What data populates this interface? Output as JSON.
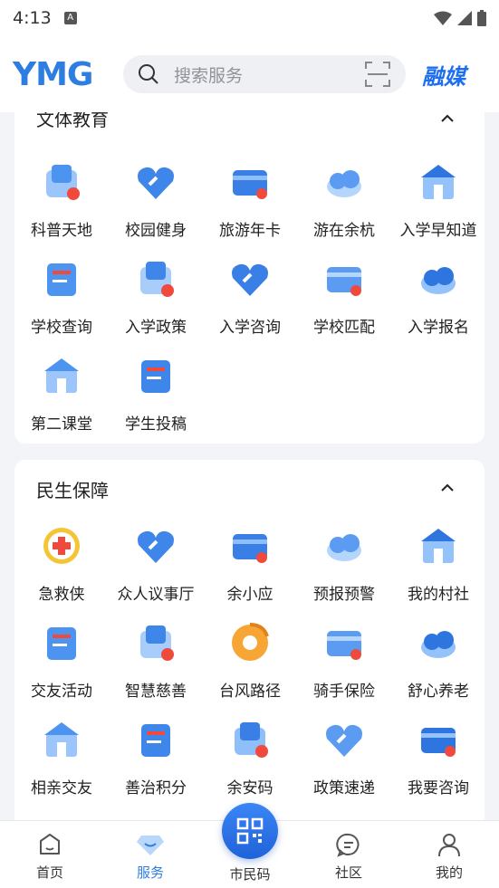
{
  "status": {
    "time": "4:13"
  },
  "header": {
    "logo": "YMG",
    "search_placeholder": "搜索服务",
    "brand": "融媒"
  },
  "culture": {
    "title": "文体教育",
    "items": [
      {
        "label": "科普天地",
        "icon": "orbit-icon"
      },
      {
        "label": "校园健身",
        "icon": "fitness-icon"
      },
      {
        "label": "旅游年卡",
        "icon": "travel-card-icon"
      },
      {
        "label": "游在余杭",
        "icon": "tourism-icon"
      },
      {
        "label": "入学早知道",
        "icon": "school-building-icon"
      },
      {
        "label": "学校查询",
        "icon": "school-query-icon"
      },
      {
        "label": "入学政策",
        "icon": "books-icon"
      },
      {
        "label": "入学咨询",
        "icon": "consult-icon"
      },
      {
        "label": "学校匹配",
        "icon": "flag-icon"
      },
      {
        "label": "入学报名",
        "icon": "register-icon"
      },
      {
        "label": "第二课堂",
        "icon": "classroom-icon"
      },
      {
        "label": "学生投稿",
        "icon": "mail-icon"
      }
    ]
  },
  "livelihood": {
    "title": "民生保障",
    "items": [
      {
        "label": "急救侠",
        "icon": "first-aid-icon"
      },
      {
        "label": "众人议事厅",
        "icon": "cloud-hall-icon"
      },
      {
        "label": "余小应",
        "icon": "handshake-icon"
      },
      {
        "label": "预报预警",
        "icon": "weather-icon"
      },
      {
        "label": "我的村社",
        "icon": "village-icon"
      },
      {
        "label": "交友活动",
        "icon": "heart-hands-icon"
      },
      {
        "label": "智慧慈善",
        "icon": "charity-icon"
      },
      {
        "label": "台风路径",
        "icon": "typhoon-icon"
      },
      {
        "label": "骑手保险",
        "icon": "scooter-icon"
      },
      {
        "label": "舒心养老",
        "icon": "elderly-icon"
      },
      {
        "label": "相亲交友",
        "icon": "dating-icon"
      },
      {
        "label": "善治积分",
        "icon": "points-bag-icon"
      },
      {
        "label": "余安码",
        "icon": "shield-code-icon"
      },
      {
        "label": "政策速递",
        "icon": "policy-book-icon"
      },
      {
        "label": "我要咨询",
        "icon": "chat-icon"
      }
    ]
  },
  "tabbar": {
    "tabs": [
      {
        "label": "首页"
      },
      {
        "label": "服务"
      },
      {
        "label": "市民码"
      },
      {
        "label": "社区"
      },
      {
        "label": "我的"
      }
    ]
  },
  "colors": {
    "accent": "#2d7ee0",
    "red": "#ef4a3c"
  }
}
